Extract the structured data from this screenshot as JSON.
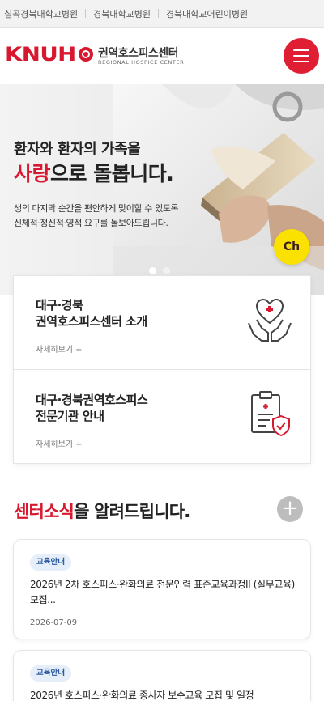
{
  "topbar": {
    "links": [
      "칠곡경북대학교병원",
      "경북대학교병원",
      "경북대학교어린이병원"
    ]
  },
  "header": {
    "logo_text": "KNUH",
    "center_name": "권역호스피스센터",
    "center_sub": "REGIONAL HOSPICE CENTER",
    "menu_icon": "hamburger-menu-icon"
  },
  "hero": {
    "title_line1": "환자와 환자의 가족을",
    "title_accent": "사랑",
    "title_rest": "으로 돌봅니다.",
    "desc_line1": "생의 마지막 순간을 편안하게 맞이할 수 있도록",
    "desc_line2": "신체적·정신적·영적 요구를 돌보아드립니다.",
    "kakao_label": "Ch",
    "slide_index": 1,
    "slide_count": 2
  },
  "cards": [
    {
      "title_line1": "대구·경북",
      "title_line2": "권역호스피스센터 소개",
      "more": "자세히보기 +",
      "icon": "heart-hands-icon"
    },
    {
      "title_line1": "대구·경북권역호스피스",
      "title_line2": "전문기관 안내",
      "more": "자세히보기 +",
      "icon": "clipboard-shield-icon"
    }
  ],
  "news": {
    "heading_accent": "센터소식",
    "heading_rest": "을 알려드립니다.",
    "more_icon": "plus-icon",
    "items": [
      {
        "badge": "교육안내",
        "title": "2026년 2차 호스피스·완화의료 전문인력 표준교육과정II (실무교육) 모집...",
        "date": "2026-07-09"
      },
      {
        "badge": "교육안내",
        "title": "2026년 호스피스·완화의료 종사자 보수교육 모집 및 일정",
        "date": ""
      }
    ]
  },
  "colors": {
    "brand_red": "#d8182e",
    "kakao_yellow": "#fae100",
    "badge_bg": "#e6eef9",
    "badge_text": "#2c5aa0"
  }
}
